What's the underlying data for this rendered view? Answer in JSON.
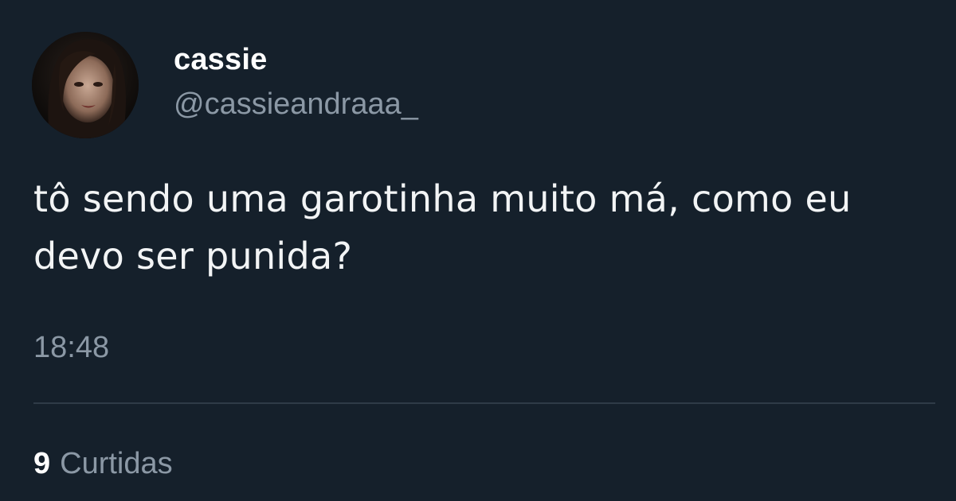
{
  "user": {
    "display_name": "cassie",
    "handle": "@cassieandraaa_"
  },
  "tweet": {
    "text": "tô sendo uma garotinha muito má, como eu devo ser punida?",
    "time": "18:48"
  },
  "stats": {
    "likes_count": "9",
    "likes_label": "Curtidas"
  },
  "colors": {
    "background": "#15202b",
    "primary_text": "#e7e9ea",
    "secondary_text": "#8b98a5",
    "divider": "#2f3b47"
  }
}
